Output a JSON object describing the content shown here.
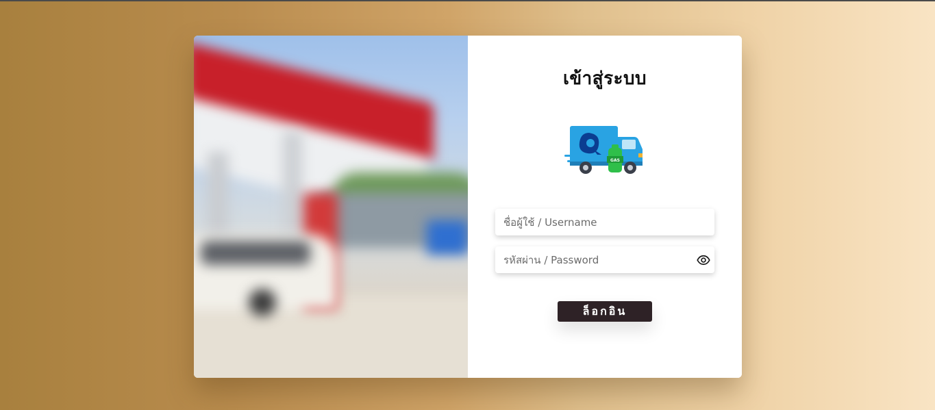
{
  "colors": {
    "background_left": "#a8803e",
    "background_right": "#f9e4c4",
    "button_bg": "#2e2226",
    "button_text": "#ffffff",
    "title_text": "#111111",
    "truck_blue": "#29a3e3",
    "gas_green": "#2fbf4a"
  },
  "login": {
    "title": "เข้าสู่ระบบ",
    "logo_icon": "gas-delivery-truck-icon",
    "logo_badge_text": "GAS",
    "username": {
      "placeholder": "ชื่อผู้ใช้ / Username",
      "value": ""
    },
    "password": {
      "placeholder": "รหัสผ่าน / Password",
      "value": "",
      "toggle_icon": "eye-icon"
    },
    "submit_label": "ล็อกอิน"
  },
  "hero_image": {
    "subject": "blurred-gas-station-photo"
  }
}
